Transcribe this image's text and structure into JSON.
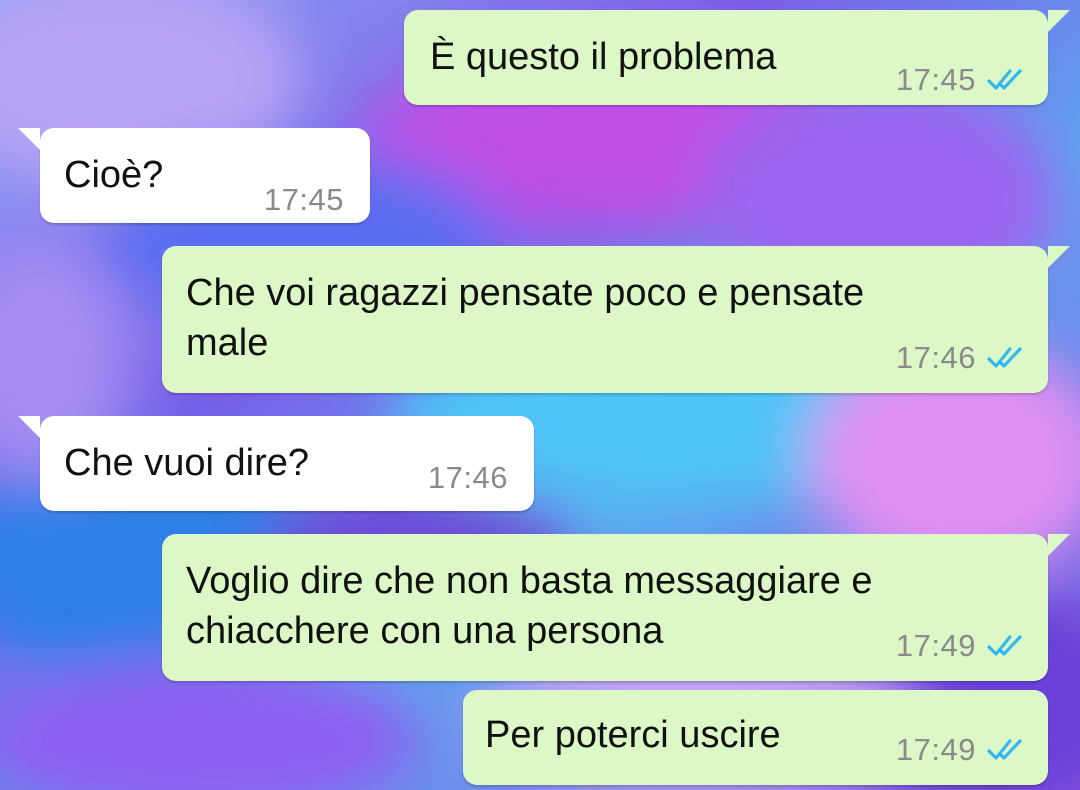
{
  "colors": {
    "outgoing_bubble": "#dcf8c6",
    "incoming_bubble": "#ffffff",
    "timestamp": "#8a8a8a",
    "read_ticks": "#34b7f1"
  },
  "messages": [
    {
      "direction": "outgoing",
      "text": "È questo il problema",
      "time": "17:45",
      "status_icon": "double-check-icon"
    },
    {
      "direction": "incoming",
      "text": "Cioè?",
      "time": "17:45"
    },
    {
      "direction": "outgoing",
      "text": "Che voi ragazzi pensate poco e pensate\nmale",
      "time": "17:46",
      "status_icon": "double-check-icon"
    },
    {
      "direction": "incoming",
      "text": "Che vuoi dire?",
      "time": "17:46"
    },
    {
      "direction": "outgoing",
      "text": "Voglio dire che non basta messaggiare e\nchiacchere con una persona",
      "time": "17:49",
      "status_icon": "double-check-icon"
    },
    {
      "direction": "outgoing",
      "text": "Per poterci uscire",
      "time": "17:49",
      "status_icon": "double-check-icon"
    }
  ]
}
